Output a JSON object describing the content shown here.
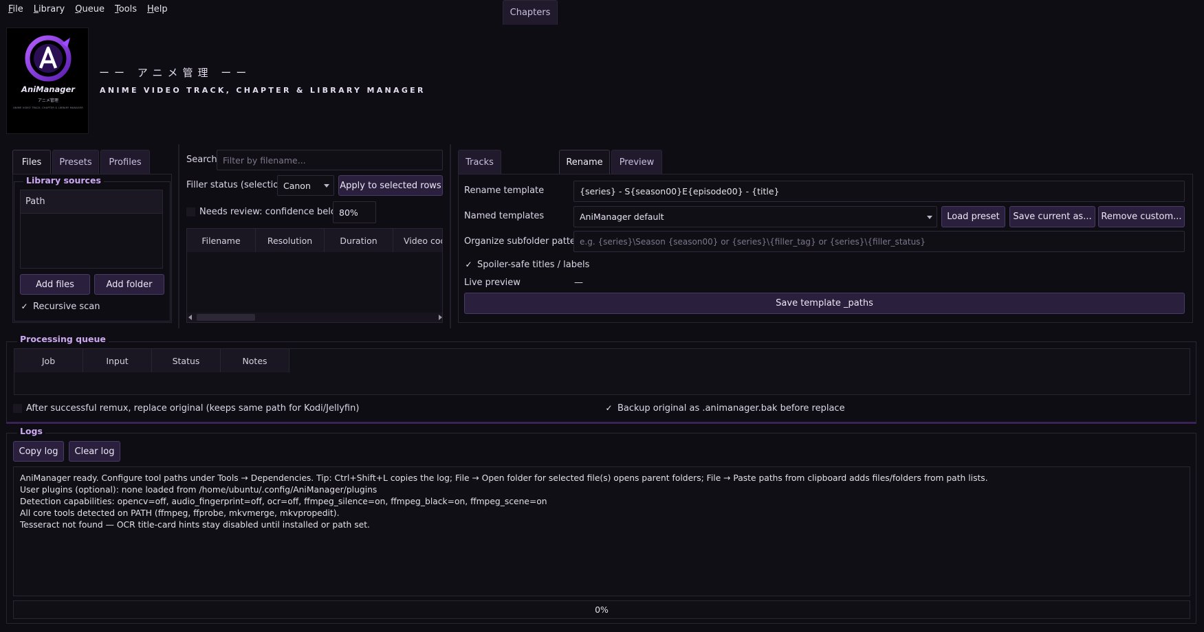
{
  "menu": [
    {
      "u": "F",
      "rest": "ile"
    },
    {
      "u": "L",
      "rest": "ibrary"
    },
    {
      "u": "Q",
      "rest": "ueue"
    },
    {
      "u": "T",
      "rest": "ools"
    },
    {
      "u": "H",
      "rest": "elp"
    }
  ],
  "header": {
    "logo_name": "AniManager",
    "logo_jp": "アニメ管理",
    "logo_tagline": "ANIME VIDEO TRACK, CHAPTER & LIBRARY MANAGER",
    "title_jp": "ーー アニメ管理 ーー",
    "subtitle": "ANIME VIDEO TRACK, CHAPTER & LIBRARY MANAGER"
  },
  "left_tabs": [
    "Files",
    "Presets",
    "Profiles"
  ],
  "library": {
    "group_title": "Library sources",
    "column_header": "Path",
    "add_files": "Add files",
    "add_folder": "Add folder",
    "recursive_label": "Recursive scan",
    "recursive_checked": true
  },
  "middle": {
    "search_label": "Search",
    "search_placeholder": "Filter by filename...",
    "filler_label": "Filler status (selection)",
    "filler_value": "Canon",
    "apply_button": "Apply to selected rows",
    "needs_review_label": "Needs review: confidence below",
    "confidence_value": "80%",
    "columns": [
      "Filename",
      "Resolution",
      "Duration",
      "Video cod"
    ]
  },
  "right_tabs": [
    "Tracks",
    "Chapters",
    "Rename",
    "Preview"
  ],
  "rename": {
    "template_label": "Rename template",
    "template_value": "{series} - S{season00}E{episode00} - {title}",
    "named_label": "Named templates",
    "named_value": "AniManager default",
    "load_preset": "Load preset",
    "save_current": "Save current as...",
    "remove_custom": "Remove custom...",
    "subfolder_label": "Organize subfolder pattern",
    "subfolder_placeholder": "e.g. {series}\\Season {season00}  or  {series}\\{filler_tag}  or  {series}\\{filler_status}",
    "spoiler_label": "Spoiler-safe titles / labels",
    "spoiler_checked": true,
    "live_preview_label": "Live preview",
    "live_preview_value": "—",
    "save_paths_button": "Save template _paths"
  },
  "queue": {
    "group_title": "Processing queue",
    "columns": [
      "Job",
      "Input",
      "Status",
      "Notes"
    ],
    "replace_label": "After successful remux, replace original (keeps same path for Kodi/Jellyfin)",
    "replace_checked": false,
    "backup_label": "Backup original as .animanager.bak before replace",
    "backup_checked": true
  },
  "logs": {
    "group_title": "Logs",
    "copy_button": "Copy log",
    "clear_button": "Clear log",
    "lines": [
      "AniManager ready. Configure tool paths under Tools → Dependencies. Tip: Ctrl+Shift+L copies the log; File → Open folder for selected file(s) opens parent folders; File → Paste paths from clipboard adds files/folders from path lists.",
      "User plugins (optional): none loaded from /home/ubuntu/.config/AniManager/plugins",
      "Detection capabilities: opencv=off, audio_fingerprint=off, ocr=off, ffmpeg_silence=on, ffmpeg_black=on, ffmpeg_scene=on",
      "All core tools detected on PATH (ffmpeg, ffprobe, mkvmerge, mkvpropedit).",
      "Tesseract not found — OCR title-card hints stay disabled until installed or path set."
    ],
    "progress_text": "0%",
    "progress_value": 0
  },
  "colors": {
    "accent": "#7b3fd6",
    "background": "#0f0d14",
    "button": "#2a1f3d"
  }
}
